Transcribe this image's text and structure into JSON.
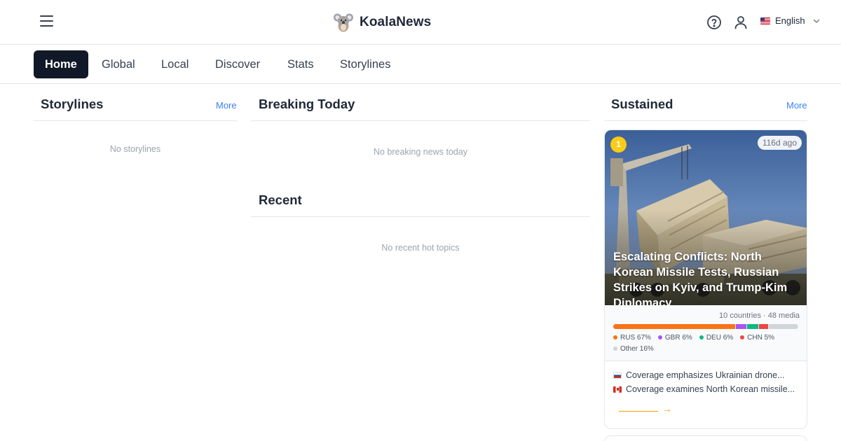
{
  "header": {
    "brand": "KoalaNews",
    "language": "English"
  },
  "nav": {
    "items": [
      "Home",
      "Global",
      "Local",
      "Discover",
      "Stats",
      "Storylines"
    ],
    "active": "Home"
  },
  "storylines": {
    "title": "Storylines",
    "more": "More",
    "empty": "No storylines"
  },
  "breaking": {
    "title": "Breaking Today",
    "empty": "No breaking news today"
  },
  "recent": {
    "title": "Recent",
    "empty": "No recent hot topics"
  },
  "sustained": {
    "title": "Sustained",
    "more": "More",
    "card": {
      "rank": "1",
      "age": "116d ago",
      "title": "Escalating Conflicts: North Korean Missile Tests, Russian Strikes on Kyiv, and Trump-Kim Diplomacy",
      "meta": "10 countries · 48 media",
      "distribution": [
        {
          "code": "RUS",
          "label": "RUS 67%",
          "percent": 67,
          "color": "#f97316"
        },
        {
          "code": "GBR",
          "label": "GBR 6%",
          "percent": 6,
          "color": "#a855f7"
        },
        {
          "code": "DEU",
          "label": "DEU 6%",
          "percent": 6,
          "color": "#10b981"
        },
        {
          "code": "CHN",
          "label": "CHN 5%",
          "percent": 5,
          "color": "#ef4444"
        },
        {
          "code": "Other",
          "label": "Other 16%",
          "percent": 16,
          "color": "#d1d5db"
        }
      ],
      "coverage": [
        {
          "flag": "russia-flag",
          "text": "Coverage emphasizes Ukrainian drone..."
        },
        {
          "flag": "canada-flag",
          "text": "Coverage examines North Korean missile..."
        }
      ],
      "arrow": "→"
    }
  }
}
